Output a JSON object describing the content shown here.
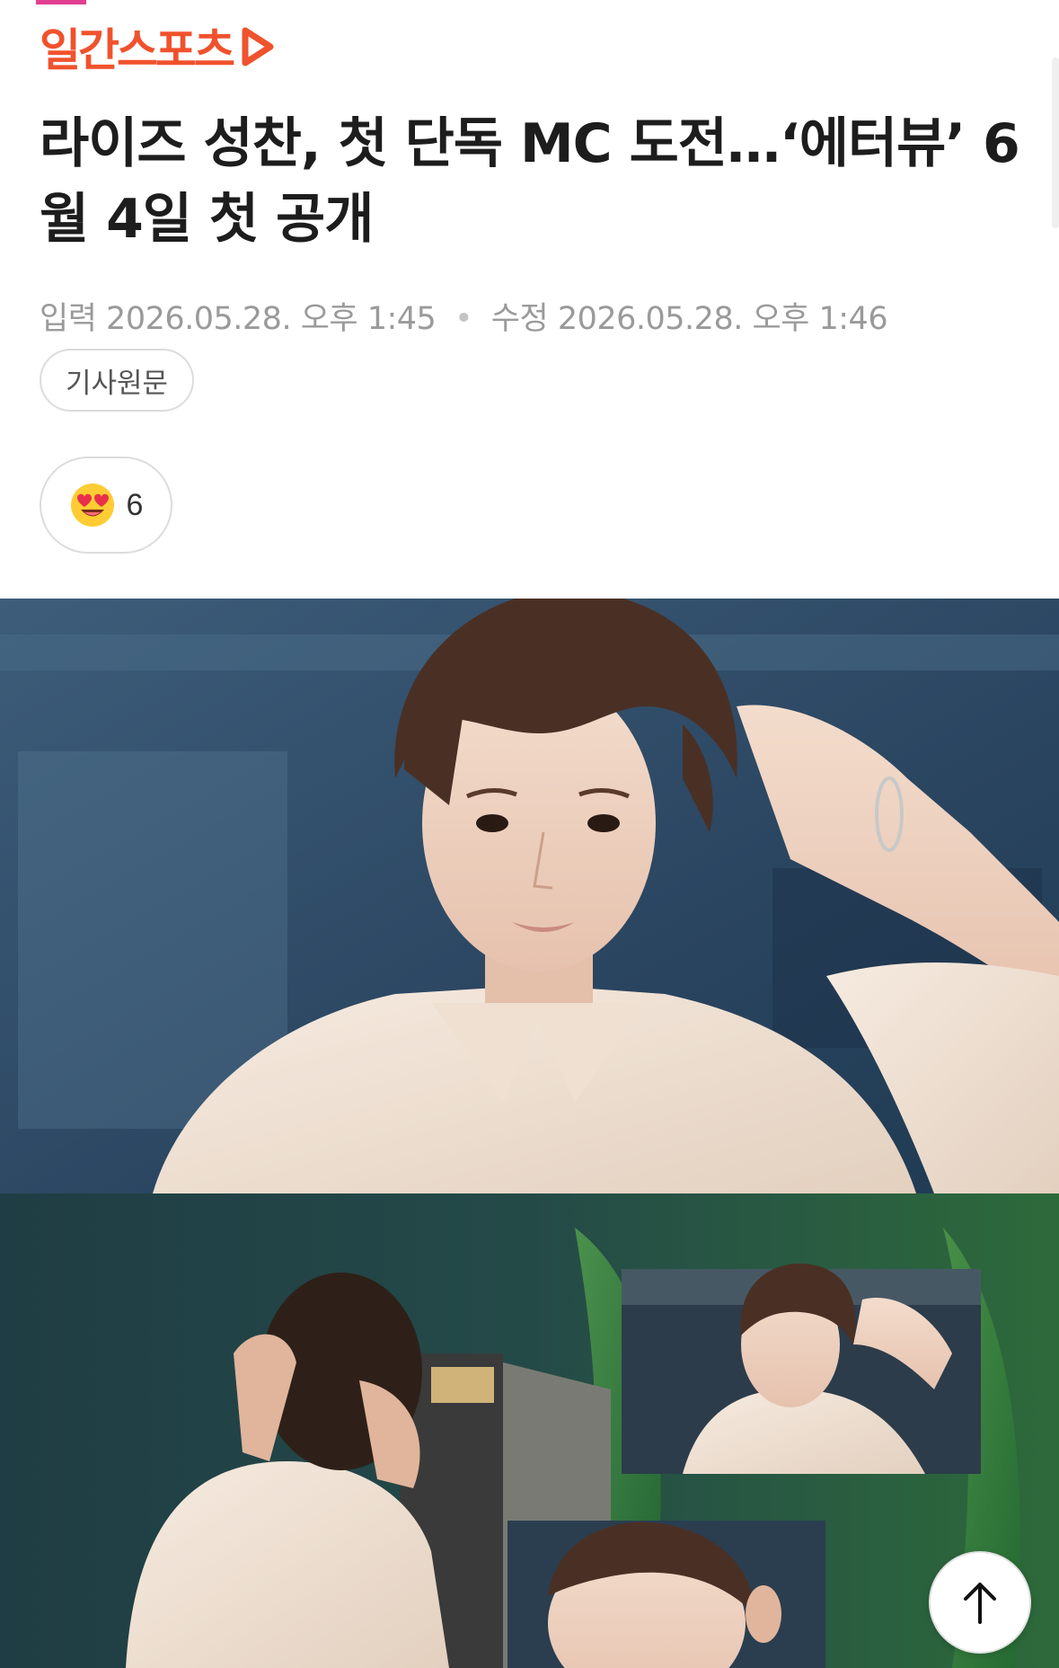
{
  "header": {
    "logo_text": "일간스포츠",
    "brand_color": "#f0522d",
    "accent_color": "#e0408f"
  },
  "article": {
    "title": "라이즈 성찬, 첫 단독 MC 도전…‘에터뷰’ 6월 4일 첫 공개",
    "input_label": "입력",
    "input_time": "2026.05.28. 오후 1:45",
    "separator": "•",
    "edit_label": "수정",
    "edit_time": "2026.05.28. 오후 1:46",
    "original_button": "기사원문",
    "reaction": {
      "icon": "heart-eyes-emoji-icon",
      "count": "6"
    }
  },
  "photo": {
    "description_icon": "article-photo"
  },
  "controls": {
    "scroll_top_icon": "arrow-up-icon"
  }
}
